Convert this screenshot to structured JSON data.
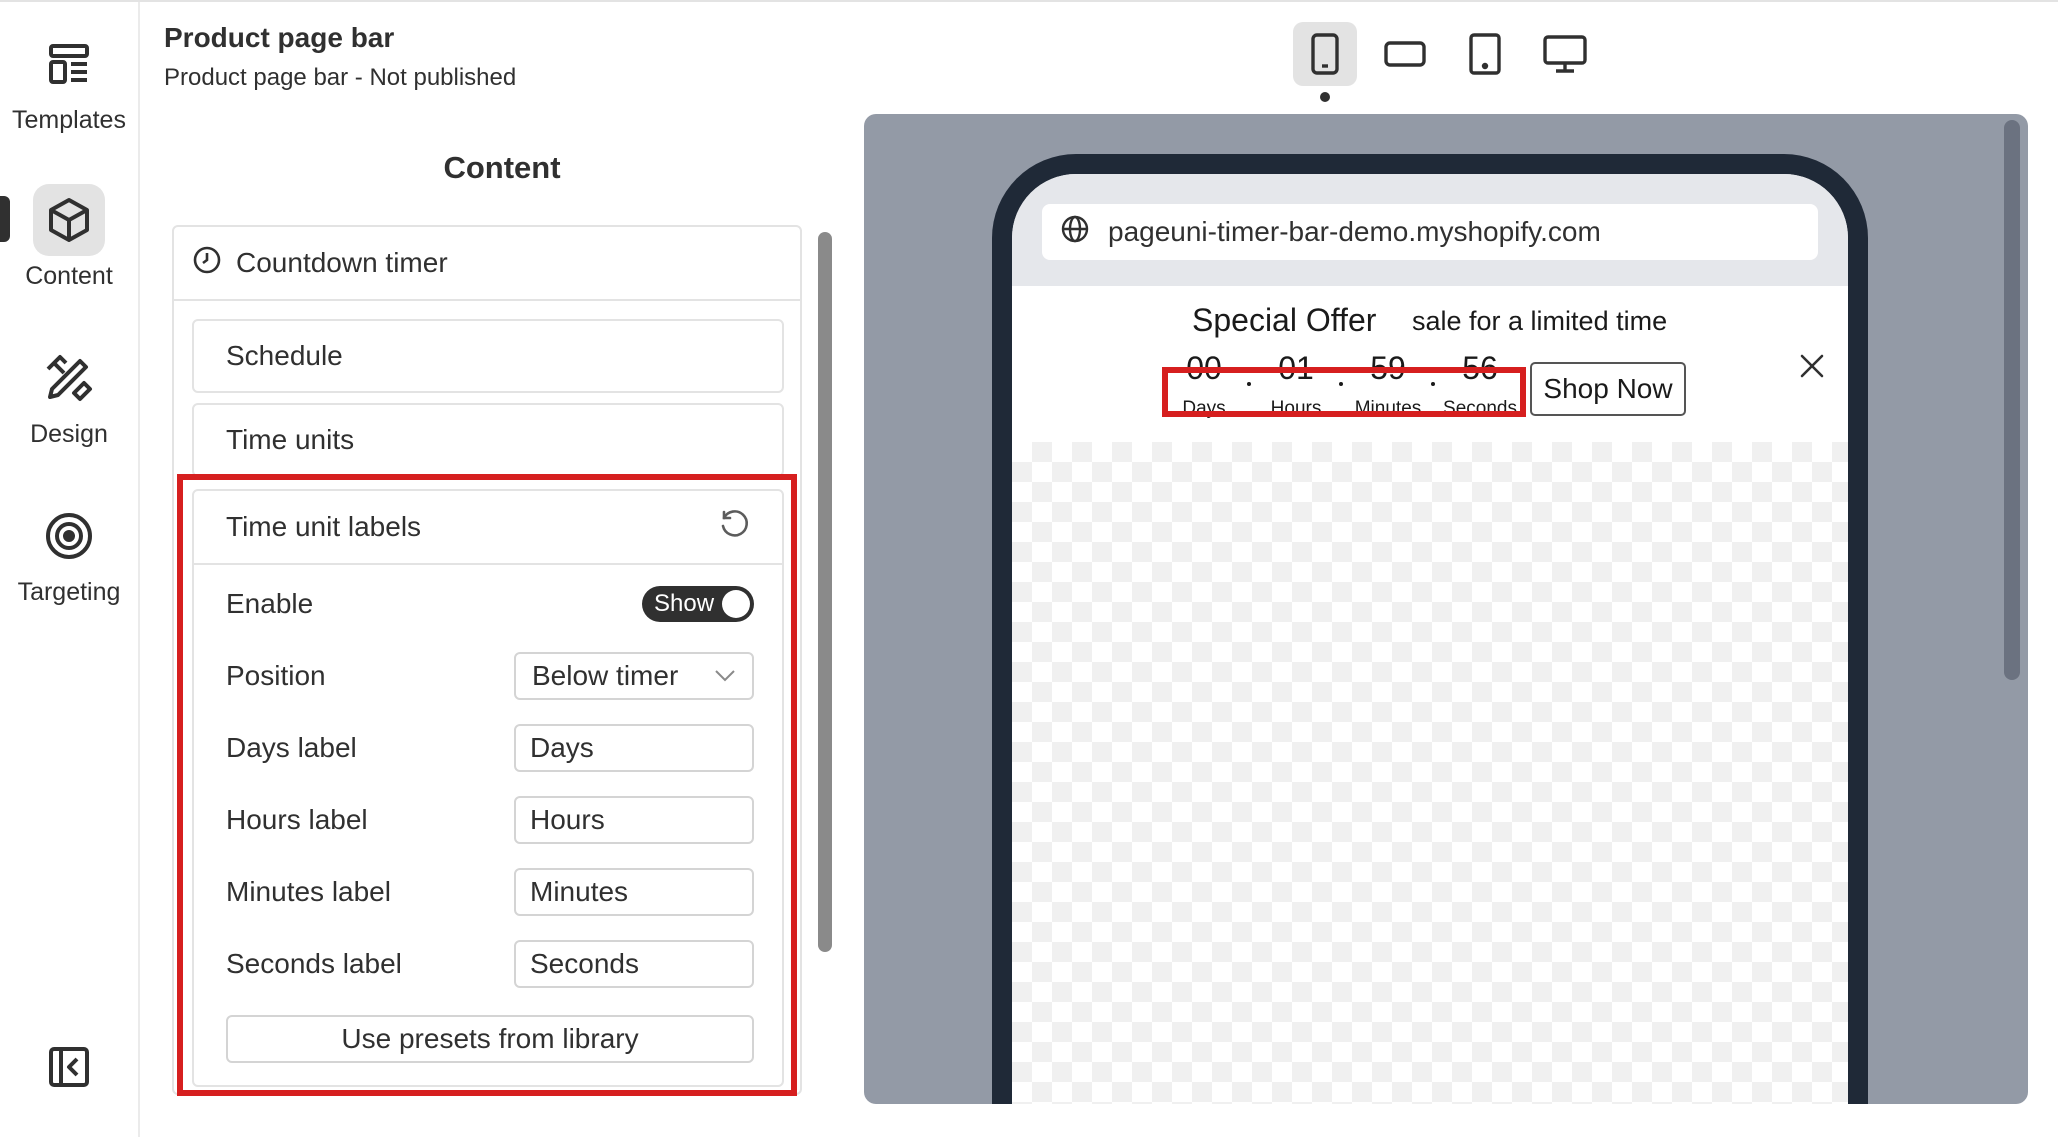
{
  "rail": {
    "items": [
      {
        "label": "Templates",
        "icon": "templates-icon"
      },
      {
        "label": "Content",
        "icon": "cube-icon"
      },
      {
        "label": "Design",
        "icon": "design-tools-icon"
      },
      {
        "label": "Targeting",
        "icon": "target-icon"
      }
    ],
    "active": "Content"
  },
  "header": {
    "title": "Product page bar",
    "subtitle": "Product page bar - Not published"
  },
  "content": {
    "title": "Content",
    "section": "Countdown timer",
    "cards": [
      "Schedule",
      "Time units"
    ],
    "time_unit_labels": {
      "title": "Time unit labels",
      "enable_label": "Enable",
      "toggle_text": "Show",
      "position_label": "Position",
      "position_value": "Below timer",
      "days_label": "Days label",
      "days_value": "Days",
      "hours_label": "Hours label",
      "hours_value": "Hours",
      "minutes_label": "Minutes label",
      "minutes_value": "Minutes",
      "seconds_label": "Seconds label",
      "seconds_value": "Seconds",
      "preset_button": "Use presets from library"
    }
  },
  "devices": [
    "mobile",
    "mobile-landscape",
    "tablet",
    "desktop"
  ],
  "preview": {
    "url": "pageuni-timer-bar-demo.myshopify.com",
    "offer_title": "Special Offer",
    "offer_subtitle": "sale for a limited time",
    "timer": {
      "days": "00",
      "hours": "01",
      "minutes": "59",
      "seconds": "56",
      "days_label": "Days",
      "hours_label": "Hours",
      "minutes_label": "Minutes",
      "seconds_label": "Seconds"
    },
    "button": "Shop Now"
  },
  "colors": {
    "highlight": "#d61f1f",
    "preview_bg": "#939aa6",
    "phone_frame": "#1f2937",
    "toggle_on": "#303030"
  }
}
